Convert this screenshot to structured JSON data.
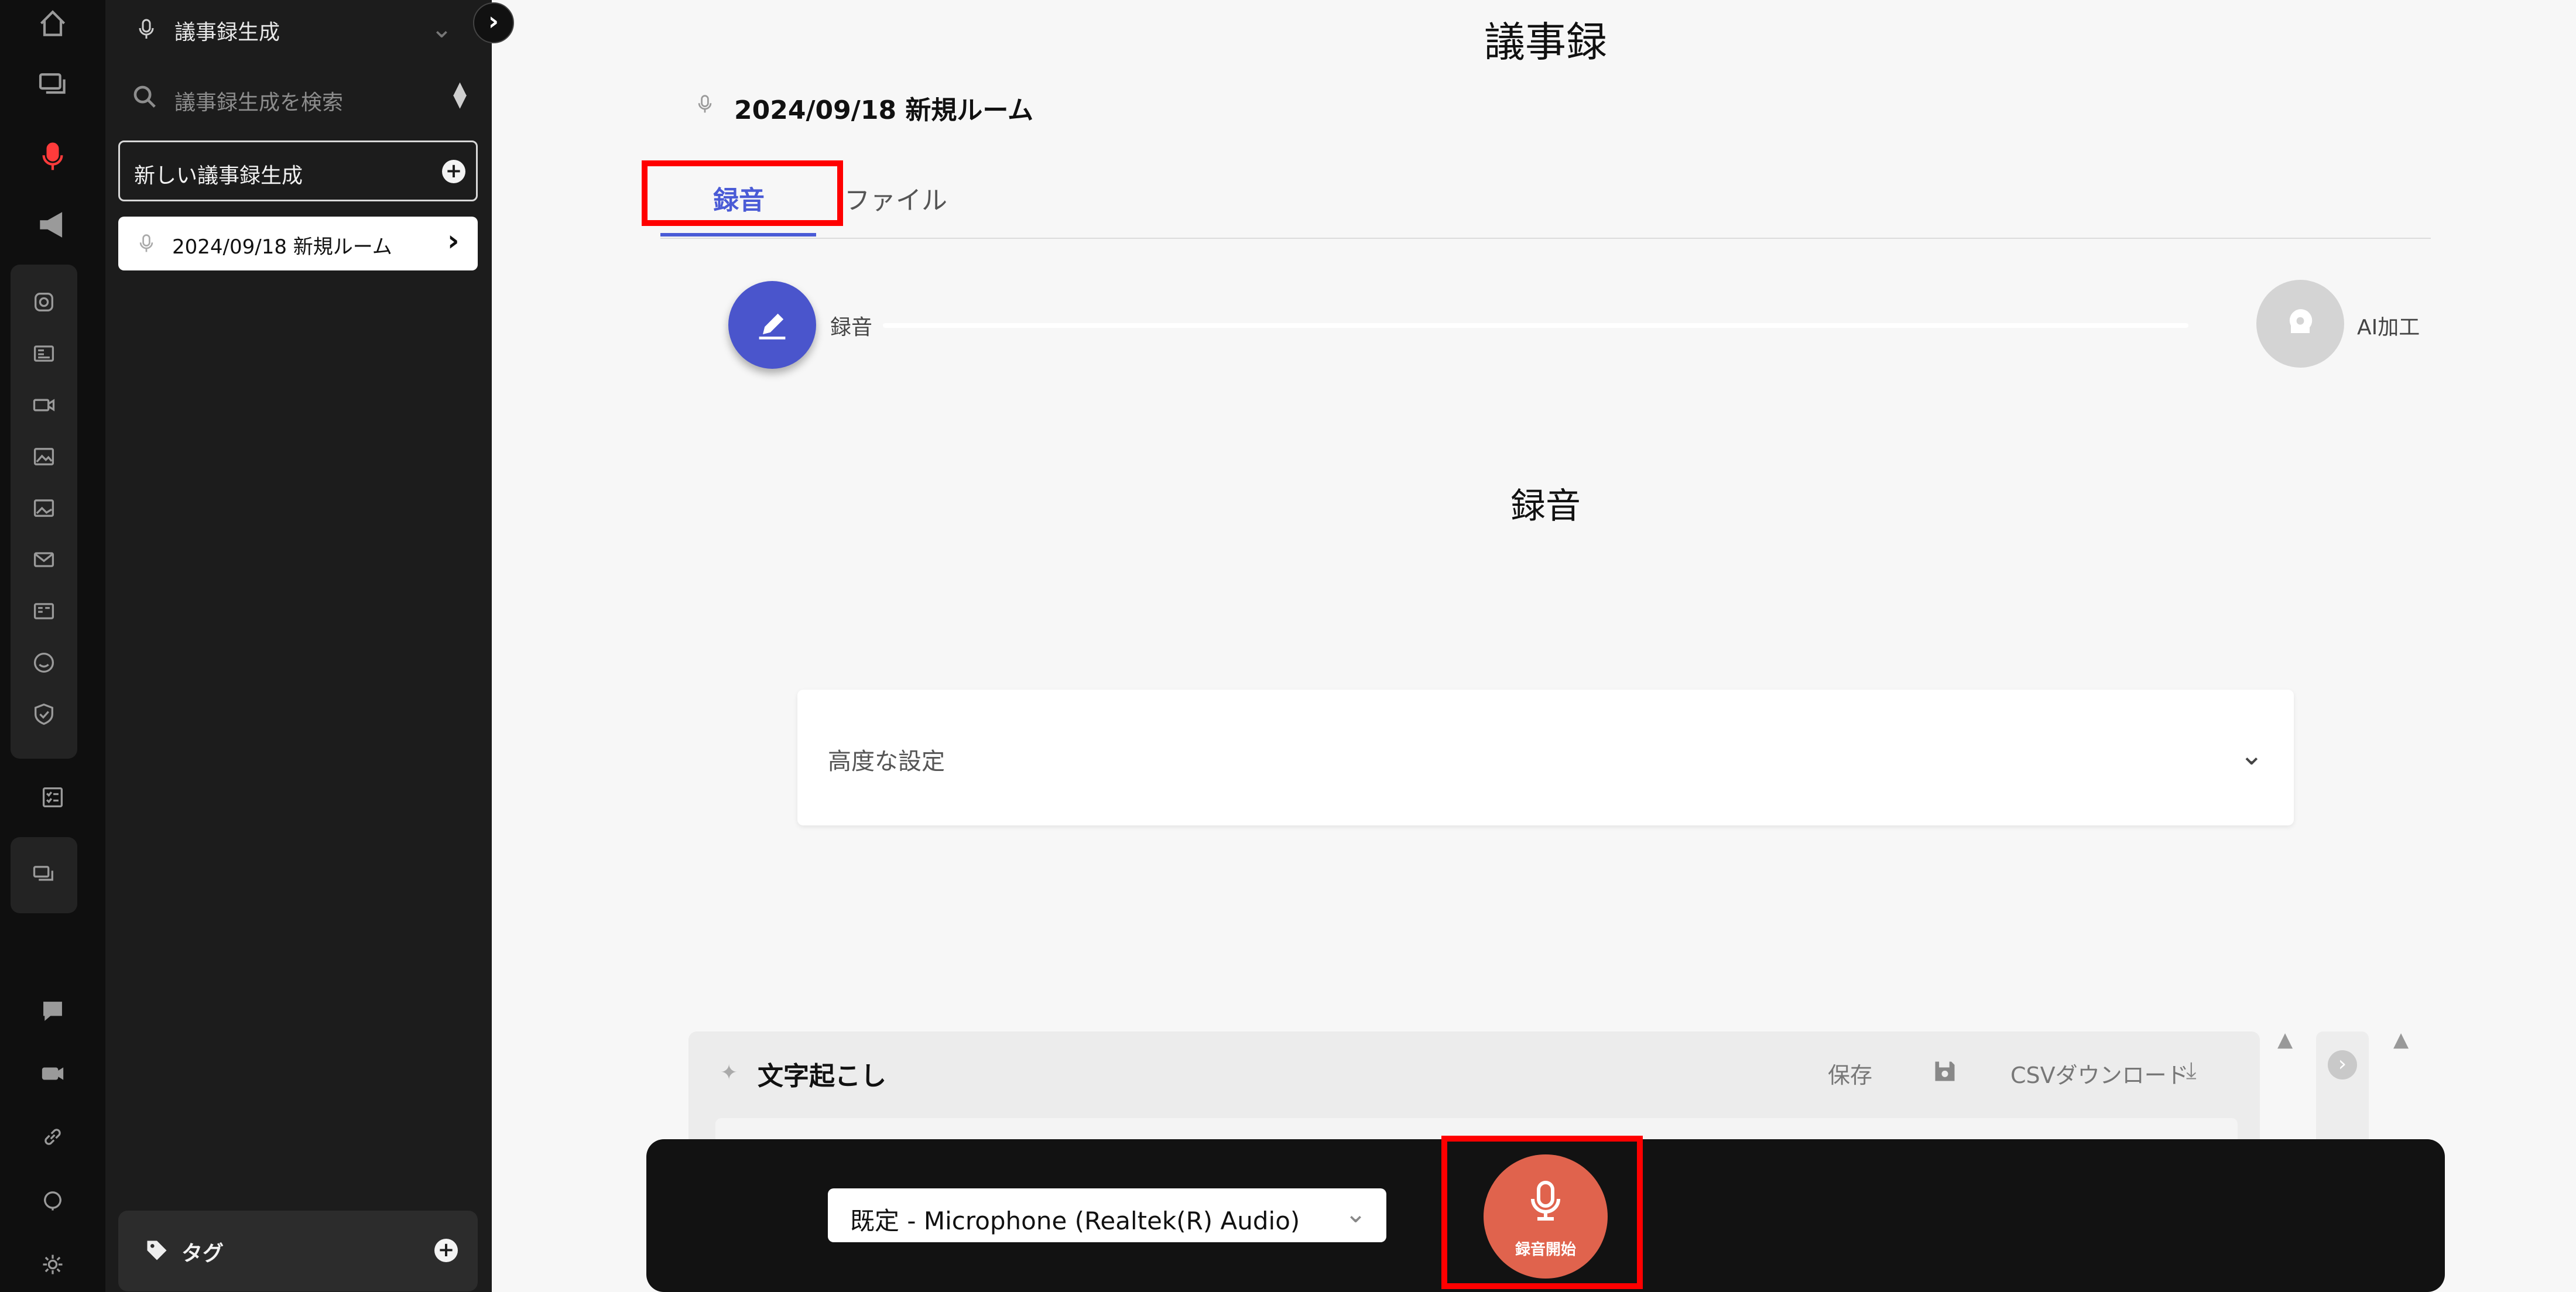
{
  "sidebar": {
    "title": "議事録生成",
    "search_placeholder": "議事録生成を検索",
    "new_button": "新しい議事録生成",
    "room_item": "2024/09/18 新規ルーム",
    "tag_label": "タグ"
  },
  "main": {
    "page_title": "議事録",
    "room_name": "2024/09/18 新規ルーム",
    "tabs": [
      {
        "label": "録音",
        "active": true
      },
      {
        "label": "ファイル",
        "active": false
      }
    ],
    "steps": [
      {
        "label": "録音",
        "active": true
      },
      {
        "label": "AI加工",
        "active": false
      }
    ],
    "section_title": "録音",
    "advanced_settings": "高度な設定",
    "transcript": {
      "title": "文字起こし",
      "save": "保存",
      "csv": "CSVダウンロード"
    }
  },
  "recorder": {
    "mic_selected": "既定 - Microphone (Realtek(R) Audio)",
    "start_label": "録音開始"
  },
  "colors": {
    "accent": "#4a5bd6",
    "record_button": "#e0634d",
    "highlight": "#ff0000"
  }
}
